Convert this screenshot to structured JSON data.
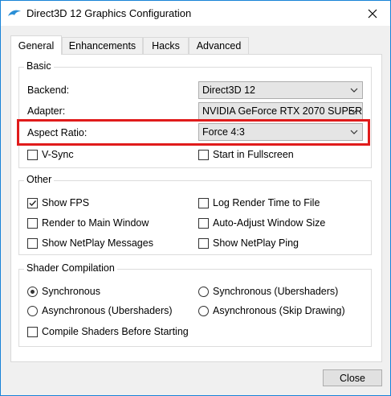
{
  "window": {
    "title": "Direct3D 12 Graphics Configuration"
  },
  "tabs": [
    {
      "label": "General",
      "active": true
    },
    {
      "label": "Enhancements",
      "active": false
    },
    {
      "label": "Hacks",
      "active": false
    },
    {
      "label": "Advanced",
      "active": false
    }
  ],
  "basic": {
    "title": "Basic",
    "backend_label": "Backend:",
    "backend_value": "Direct3D 12",
    "adapter_label": "Adapter:",
    "adapter_value": "NVIDIA GeForce RTX 2070 SUPER",
    "aspect_label": "Aspect Ratio:",
    "aspect_value": "Force 4:3",
    "vsync": {
      "label": "V-Sync",
      "checked": false
    },
    "fullscreen": {
      "label": "Start in Fullscreen",
      "checked": false
    }
  },
  "other": {
    "title": "Other",
    "items": [
      {
        "label": "Show FPS",
        "checked": true
      },
      {
        "label": "Log Render Time to File",
        "checked": false
      },
      {
        "label": "Render to Main Window",
        "checked": false
      },
      {
        "label": "Auto-Adjust Window Size",
        "checked": false
      },
      {
        "label": "Show NetPlay Messages",
        "checked": false
      },
      {
        "label": "Show NetPlay Ping",
        "checked": false
      }
    ]
  },
  "shader": {
    "title": "Shader Compilation",
    "options": [
      {
        "label": "Synchronous",
        "selected": true
      },
      {
        "label": "Synchronous (Ubershaders)",
        "selected": false
      },
      {
        "label": "Asynchronous (Ubershaders)",
        "selected": false
      },
      {
        "label": "Asynchronous (Skip Drawing)",
        "selected": false
      }
    ],
    "compile_before": {
      "label": "Compile Shaders Before Starting",
      "checked": false
    }
  },
  "buttons": {
    "close": "Close"
  },
  "colors": {
    "highlight": "#e01b1b",
    "accent": "#1883d7"
  }
}
